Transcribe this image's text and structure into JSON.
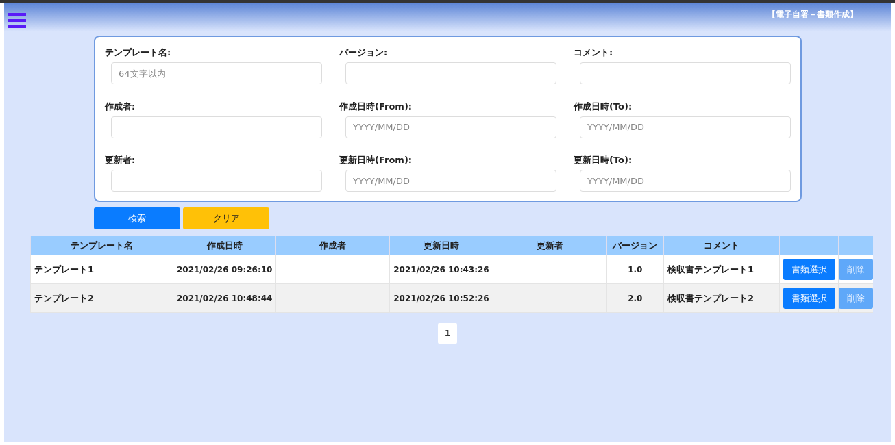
{
  "header": {
    "title": "【電子自署－書類作成】"
  },
  "search_form": {
    "fields": [
      {
        "label": "テンプレート名:",
        "placeholder": "64文字以内"
      },
      {
        "label": "バージョン:"
      },
      {
        "label": "コメント:"
      },
      {
        "label": "作成者:"
      },
      {
        "label": "作成日時(From):",
        "placeholder": "YYYY/MM/DD"
      },
      {
        "label": "作成日時(To):",
        "placeholder": "YYYY/MM/DD"
      },
      {
        "label": "更新者:"
      },
      {
        "label": "更新日時(From):",
        "placeholder": "YYYY/MM/DD"
      },
      {
        "label": "更新日時(To):",
        "placeholder": "YYYY/MM/DD"
      }
    ],
    "buttons": [
      {
        "label": "検索",
        "kind": "primary"
      },
      {
        "label": "クリア",
        "kind": "warning"
      }
    ]
  },
  "table": {
    "columns": [
      "テンプレート名",
      "作成日時",
      "作成者",
      "更新日時",
      "更新者",
      "バージョン",
      "コメント"
    ],
    "rows": [
      {
        "cells": [
          "テンプレート1",
          "2021/02/26 09:26:10",
          "",
          "2021/02/26 10:43:26",
          "",
          "1.0",
          "検収書テンプレート1"
        ],
        "select_button": "書類選択",
        "delete_button": {
          "label": "削除",
          "disabled": true
        }
      },
      {
        "cells": [
          "テンプレート2",
          "2021/02/26 10:48:44",
          "",
          "2021/02/26 10:52:26",
          "",
          "2.0",
          "検収書テンプレート2"
        ],
        "select_button": "書類選択",
        "delete_button": {
          "label": "削除",
          "disabled": true
        }
      }
    ]
  },
  "pagination": [
    {
      "label": "1",
      "selected": true
    }
  ]
}
